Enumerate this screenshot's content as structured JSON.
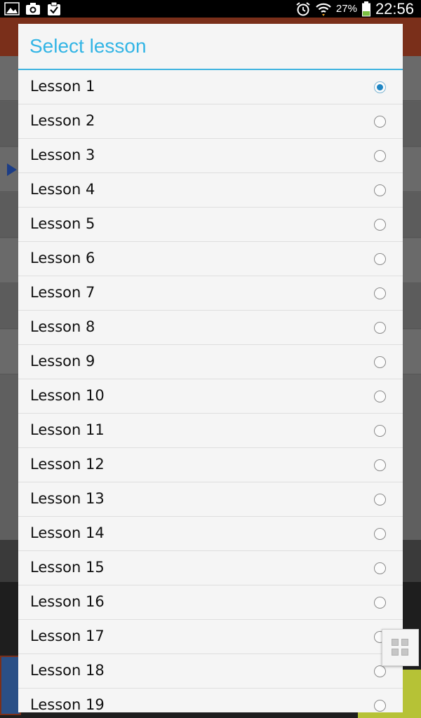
{
  "status_bar": {
    "battery_percent": "27%",
    "time": "22:56",
    "icons": [
      "gallery-icon",
      "camera-icon",
      "clipboard-check-icon",
      "alarm-icon",
      "wifi-icon",
      "battery-icon"
    ]
  },
  "dialog": {
    "title": "Select lesson",
    "accent_color": "#33b5e5",
    "selected_index": 0,
    "items": [
      {
        "label": "Lesson 1"
      },
      {
        "label": "Lesson 2"
      },
      {
        "label": "Lesson 3"
      },
      {
        "label": "Lesson 4"
      },
      {
        "label": "Lesson 5"
      },
      {
        "label": "Lesson 6"
      },
      {
        "label": "Lesson 7"
      },
      {
        "label": "Lesson 8"
      },
      {
        "label": "Lesson 9"
      },
      {
        "label": "Lesson 10"
      },
      {
        "label": "Lesson 11"
      },
      {
        "label": "Lesson 12"
      },
      {
        "label": "Lesson 13"
      },
      {
        "label": "Lesson 14"
      },
      {
        "label": "Lesson 15"
      },
      {
        "label": "Lesson 16"
      },
      {
        "label": "Lesson 17"
      },
      {
        "label": "Lesson 18"
      },
      {
        "label": "Lesson 19"
      }
    ]
  },
  "floating_button": {
    "icon": "grid-icon"
  }
}
